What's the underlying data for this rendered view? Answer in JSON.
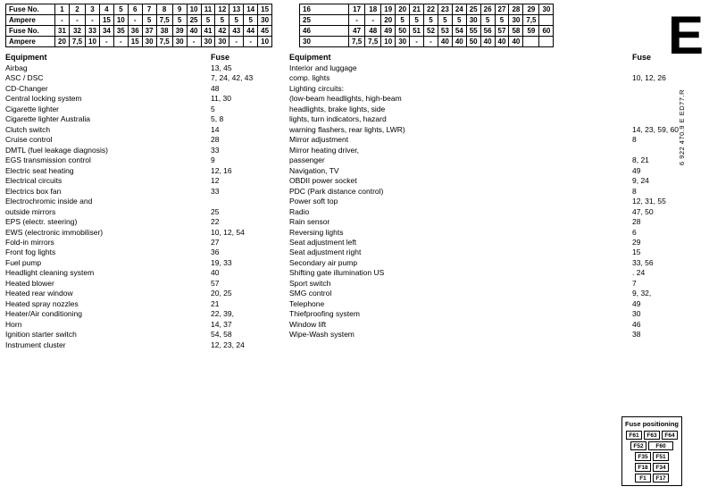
{
  "tables": {
    "left_top": {
      "row1_label": "Fuse No.",
      "row1_values": [
        "1",
        "2",
        "3",
        "4",
        "5",
        "6",
        "7",
        "8",
        "9",
        "10",
        "11",
        "12",
        "13",
        "14",
        "15"
      ],
      "row2_label": "Ampere",
      "row2_values": [
        "-",
        "-",
        "-",
        "15",
        "10",
        "-",
        "5",
        "7,5",
        "5",
        "25",
        "5",
        "5",
        "5",
        "5",
        "30"
      ],
      "row3_label": "Fuse No.",
      "row3_values": [
        "31",
        "32",
        "33",
        "34",
        "35",
        "36",
        "37",
        "38",
        "39",
        "40",
        "41",
        "42",
        "43",
        "44",
        "45"
      ],
      "row4_label": "Ampere",
      "row4_values": [
        "20",
        "7,5",
        "10",
        "-",
        "-",
        "15",
        "30",
        "7,5",
        "30",
        "-",
        "30",
        "30",
        "-",
        "-",
        "10"
      ]
    },
    "right_top": {
      "row1_values": [
        "16",
        "17",
        "18",
        "19",
        "20",
        "21",
        "22",
        "23",
        "24",
        "25",
        "26",
        "27",
        "28",
        "29",
        "30"
      ],
      "row2_values": [
        "25",
        "-",
        "-",
        "20",
        "5",
        "5",
        "5",
        "5",
        "5",
        "30",
        "5",
        "5",
        "30",
        "7,5"
      ],
      "row3_values": [
        "46",
        "47",
        "48",
        "49",
        "50",
        "51",
        "52",
        "53",
        "54",
        "55",
        "56",
        "57",
        "58",
        "59",
        "60"
      ],
      "row4_values": [
        "30",
        "7,5",
        "7,5",
        "10",
        "30",
        "-",
        "-",
        "40",
        "40",
        "50",
        "40",
        "40",
        "40",
        "",
        ""
      ]
    }
  },
  "equipment_left": {
    "header_equipment": "Equipment",
    "header_fuse": "Fuse",
    "items": [
      {
        "name": "Airbag",
        "fuse": "13, 45"
      },
      {
        "name": "ASC / DSC",
        "fuse": "7, 24, 42, 43"
      },
      {
        "name": "CD-Changer",
        "fuse": "48"
      },
      {
        "name": "Central locking system",
        "fuse": "11, 30"
      },
      {
        "name": "Cigarette lighter",
        "fuse": "5"
      },
      {
        "name": "Cigarette lighter Australia",
        "fuse": "5, 8"
      },
      {
        "name": "Clutch switch",
        "fuse": "14"
      },
      {
        "name": "Cruise control",
        "fuse": "28"
      },
      {
        "name": "DMTL (fuel leakage diagnosis)",
        "fuse": "33"
      },
      {
        "name": "EGS transmission control",
        "fuse": "9"
      },
      {
        "name": "Electric seat heating",
        "fuse": "12, 16"
      },
      {
        "name": "Electrical circuits",
        "fuse": "12"
      },
      {
        "name": "Electrics box fan",
        "fuse": "33"
      },
      {
        "name": "Electrochromic inside and",
        "fuse": ""
      },
      {
        "name": "outside mirrors",
        "fuse": "25"
      },
      {
        "name": "EPS (electr. steering)",
        "fuse": "22"
      },
      {
        "name": "EWS (electronic immobiliser)",
        "fuse": "10, 12, 54"
      },
      {
        "name": "Fold-in mirrors",
        "fuse": "27"
      },
      {
        "name": "Front fog lights",
        "fuse": "36"
      },
      {
        "name": "Fuel pump",
        "fuse": "19, 33"
      },
      {
        "name": "Headlight cleaning system",
        "fuse": "40"
      },
      {
        "name": "Heated blower",
        "fuse": "57"
      },
      {
        "name": "Heated rear window",
        "fuse": "20, 25"
      },
      {
        "name": "Heated spray nozzles",
        "fuse": "21"
      },
      {
        "name": "Heater/Air conditioning",
        "fuse": "22, 39,"
      },
      {
        "name": "Horn",
        "fuse": "14, 37"
      },
      {
        "name": "Ignition starter switch",
        "fuse": "54, 58"
      },
      {
        "name": "Instrument cluster",
        "fuse": "12, 23, 24"
      }
    ]
  },
  "equipment_right": {
    "header_equipment": "Equipment",
    "header_fuse": "Fuse",
    "items": [
      {
        "name": "Interior and luggage",
        "fuse": ""
      },
      {
        "name": "comp. lights",
        "fuse": "10, 12, 26"
      },
      {
        "name": "Lighting circuits:",
        "fuse": ""
      },
      {
        "name": "(low-beam headlights, high-beam",
        "fuse": ""
      },
      {
        "name": "headlights, brake lights, side",
        "fuse": ""
      },
      {
        "name": "lights, turn indicators, hazard",
        "fuse": ""
      },
      {
        "name": "warning flashers, rear lights, LWR)",
        "fuse": "14, 23, 59, 60"
      },
      {
        "name": "Mirror adjustment",
        "fuse": "8"
      },
      {
        "name": "Mirror heating driver,",
        "fuse": ""
      },
      {
        "name": "passenger",
        "fuse": "8, 21"
      },
      {
        "name": "Navigation, TV",
        "fuse": "49"
      },
      {
        "name": "OBDII power socket",
        "fuse": "9, 24"
      },
      {
        "name": "PDC (Park distance control)",
        "fuse": "8"
      },
      {
        "name": "Power soft top",
        "fuse": "12, 31, 55"
      },
      {
        "name": "Radio",
        "fuse": "47, 50"
      },
      {
        "name": "Rain sensor",
        "fuse": "28"
      },
      {
        "name": "Reversing lights",
        "fuse": "6"
      },
      {
        "name": "Seat adjustment left",
        "fuse": "29"
      },
      {
        "name": "Seat adjustment right",
        "fuse": "15"
      },
      {
        "name": "Secondary air pump",
        "fuse": "33, 56"
      },
      {
        "name": "Shifting gate illumination US",
        "fuse": ". 24"
      },
      {
        "name": "Sport switch",
        "fuse": "7"
      },
      {
        "name": "SMG control",
        "fuse": "9, 32,"
      },
      {
        "name": "Telephone",
        "fuse": "49"
      },
      {
        "name": "Thiefproofing system",
        "fuse": "30"
      },
      {
        "name": "Window lift",
        "fuse": "46"
      },
      {
        "name": "Wipe-Wash system",
        "fuse": "38"
      }
    ]
  },
  "big_e": "E",
  "part_number": "6 922 470.9 E ED77.R",
  "fuse_positioning": {
    "title": "Fuse positioning",
    "rows": [
      [
        {
          "label": "F61",
          "wide": false
        },
        {
          "label": "F63",
          "wide": false
        },
        {
          "label": "F64",
          "wide": false
        }
      ],
      [
        {
          "label": "F52",
          "wide": false
        },
        {
          "label": "F60",
          "wide": true
        }
      ],
      [
        {
          "label": "F35",
          "wide": false
        },
        {
          "label": "F51",
          "wide": false
        }
      ],
      [
        {
          "label": "F18",
          "wide": false
        },
        {
          "label": "F34",
          "wide": false
        }
      ],
      [
        {
          "label": "F1",
          "wide": false
        },
        {
          "label": "F17",
          "wide": false
        }
      ]
    ]
  }
}
